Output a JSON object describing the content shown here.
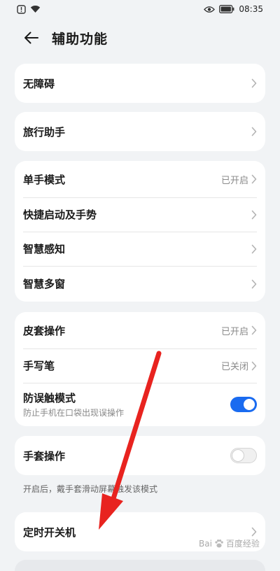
{
  "status_bar": {
    "time": "08:35",
    "left_icons": [
      "notification-icon",
      "wifi-icon"
    ],
    "right_icons": [
      "eye-icon",
      "battery-icon"
    ]
  },
  "header": {
    "title": "辅助功能",
    "back_icon": "back-arrow-icon"
  },
  "cards": {
    "accessibility": {
      "label": "无障碍"
    },
    "travel": {
      "label": "旅行助手"
    },
    "group1": {
      "one_hand": {
        "label": "单手模式",
        "value": "已开启"
      },
      "quick_launch": {
        "label": "快捷启动及手势"
      },
      "smart_sense": {
        "label": "智慧感知"
      },
      "smart_window": {
        "label": "智慧多窗"
      }
    },
    "group2": {
      "cover": {
        "label": "皮套操作",
        "value": "已开启"
      },
      "stylus": {
        "label": "手写笔",
        "value": "已关闭"
      },
      "anti_touch": {
        "label": "防误触模式",
        "sub": "防止手机在口袋出现误操作",
        "enabled": true
      }
    },
    "glove": {
      "label": "手套操作",
      "enabled": false
    },
    "glove_note": "开启后，戴手套滑动屏幕触发该模式",
    "timer": {
      "label": "定时开关机"
    }
  },
  "watermark": {
    "text": "Bai",
    "text2": "百度经验"
  },
  "colors": {
    "background": "#f1f3f5",
    "card": "#ffffff",
    "accent": "#1a6bf0",
    "annotation": "#e8231f"
  }
}
